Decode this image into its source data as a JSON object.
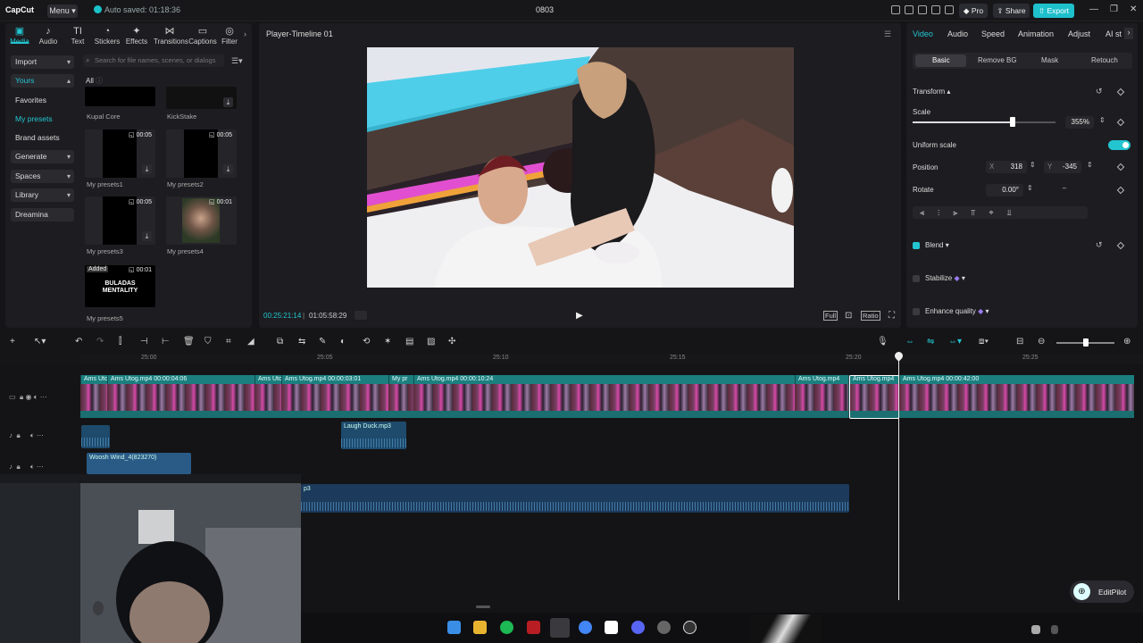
{
  "titlebar": {
    "logo": "CapCut",
    "menu_label": "Menu",
    "autosave": "Auto saved: 01:18:36",
    "project_name": "0803",
    "pro_label": "Pro",
    "share_label": "Share",
    "export_label": "Export"
  },
  "tools": [
    {
      "label": "Media",
      "icon": "media-icon"
    },
    {
      "label": "Audio",
      "icon": "audio-icon"
    },
    {
      "label": "Text",
      "icon": "text-icon"
    },
    {
      "label": "Stickers",
      "icon": "sticker-icon"
    },
    {
      "label": "Effects",
      "icon": "effects-icon"
    },
    {
      "label": "Transitions",
      "icon": "transitions-icon"
    },
    {
      "label": "Captions",
      "icon": "captions-icon"
    },
    {
      "label": "Filter",
      "icon": "filter-icon"
    }
  ],
  "sidenav": {
    "import": "Import",
    "yours": "Yours",
    "favorites": "Favorites",
    "my_presets": "My presets",
    "brand_assets": "Brand assets",
    "generate": "Generate",
    "spaces": "Spaces",
    "library": "Library",
    "dreamina": "Dreamina"
  },
  "media": {
    "search_placeholder": "Search for file names, scenes, or dialogs",
    "all_label": "All",
    "presets": [
      {
        "name": "Kupal Core",
        "duration": ""
      },
      {
        "name": "KickStake",
        "duration": ""
      },
      {
        "name": "My presets1",
        "duration": "00:05"
      },
      {
        "name": "My presets2",
        "duration": "00:05"
      },
      {
        "name": "My presets3",
        "duration": "00:05"
      },
      {
        "name": "My presets4",
        "duration": "00:01"
      },
      {
        "name": "My presets5",
        "duration": "00:01",
        "badge": "Added",
        "thumb_text": "BULADAS MENTALITY"
      }
    ]
  },
  "player": {
    "title": "Player-Timeline 01",
    "current_time": "00:25:21:14",
    "total_time": "01:05:58:29",
    "full_label": "Full",
    "ratio_label": "Ratio"
  },
  "inspector": {
    "tabs": [
      "Video",
      "Audio",
      "Speed",
      "Animation",
      "Adjust",
      "AI st"
    ],
    "subtabs": [
      "Basic",
      "Remove BG",
      "Mask",
      "Retouch"
    ],
    "transform_label": "Transform",
    "scale_label": "Scale",
    "scale_value": "355%",
    "scale_fraction": 0.7,
    "uniform_scale_label": "Uniform scale",
    "position_label": "Position",
    "pos_x_label": "X",
    "pos_x": "318",
    "pos_y_label": "Y",
    "pos_y": "-345",
    "rotate_label": "Rotate",
    "rotate_value": "0.00°",
    "rotate_dash": "–",
    "blend_label": "Blend",
    "stabilize_label": "Stabilize",
    "enhance_label": "Enhance quality"
  },
  "timeline": {
    "ruler": [
      "25:00",
      "25:05",
      "25:10",
      "25:15",
      "25:20",
      "25:25"
    ],
    "clips": [
      {
        "label": "Ams Utog",
        "start": 0,
        "width": 30
      },
      {
        "label": "Ams Utog.mp4   00:00:04:06",
        "start": 30,
        "width": 165
      },
      {
        "label": "Ams Uto",
        "start": 195,
        "width": 30
      },
      {
        "label": "Ams Utog.mp4   00:00:03:01",
        "start": 225,
        "width": 120
      },
      {
        "label": "My pr",
        "start": 345,
        "width": 28
      },
      {
        "label": "Ams Utog.mp4   00:00:10:24",
        "start": 373,
        "width": 427
      },
      {
        "label": "Ams Utog.mp4",
        "start": 800,
        "width": 60
      },
      {
        "label": "Ams Utog.mp4",
        "start": 861,
        "width": 56
      },
      {
        "label": "Ams Utog.mp4   00:00:42:00",
        "start": 917,
        "width": 263
      }
    ],
    "audio_clips": [
      {
        "label": "Laugh Duck.mp3"
      },
      {
        "label": "Woosh Wind_4(823270)"
      },
      {
        "label": "p3"
      }
    ],
    "editpilot_label": "EditPilot"
  },
  "colors": {
    "accent": "#22c5d0",
    "export": "#1ec0cc",
    "clip_head": "#1c7f7f",
    "audio_clip": "#1e4a6c"
  }
}
